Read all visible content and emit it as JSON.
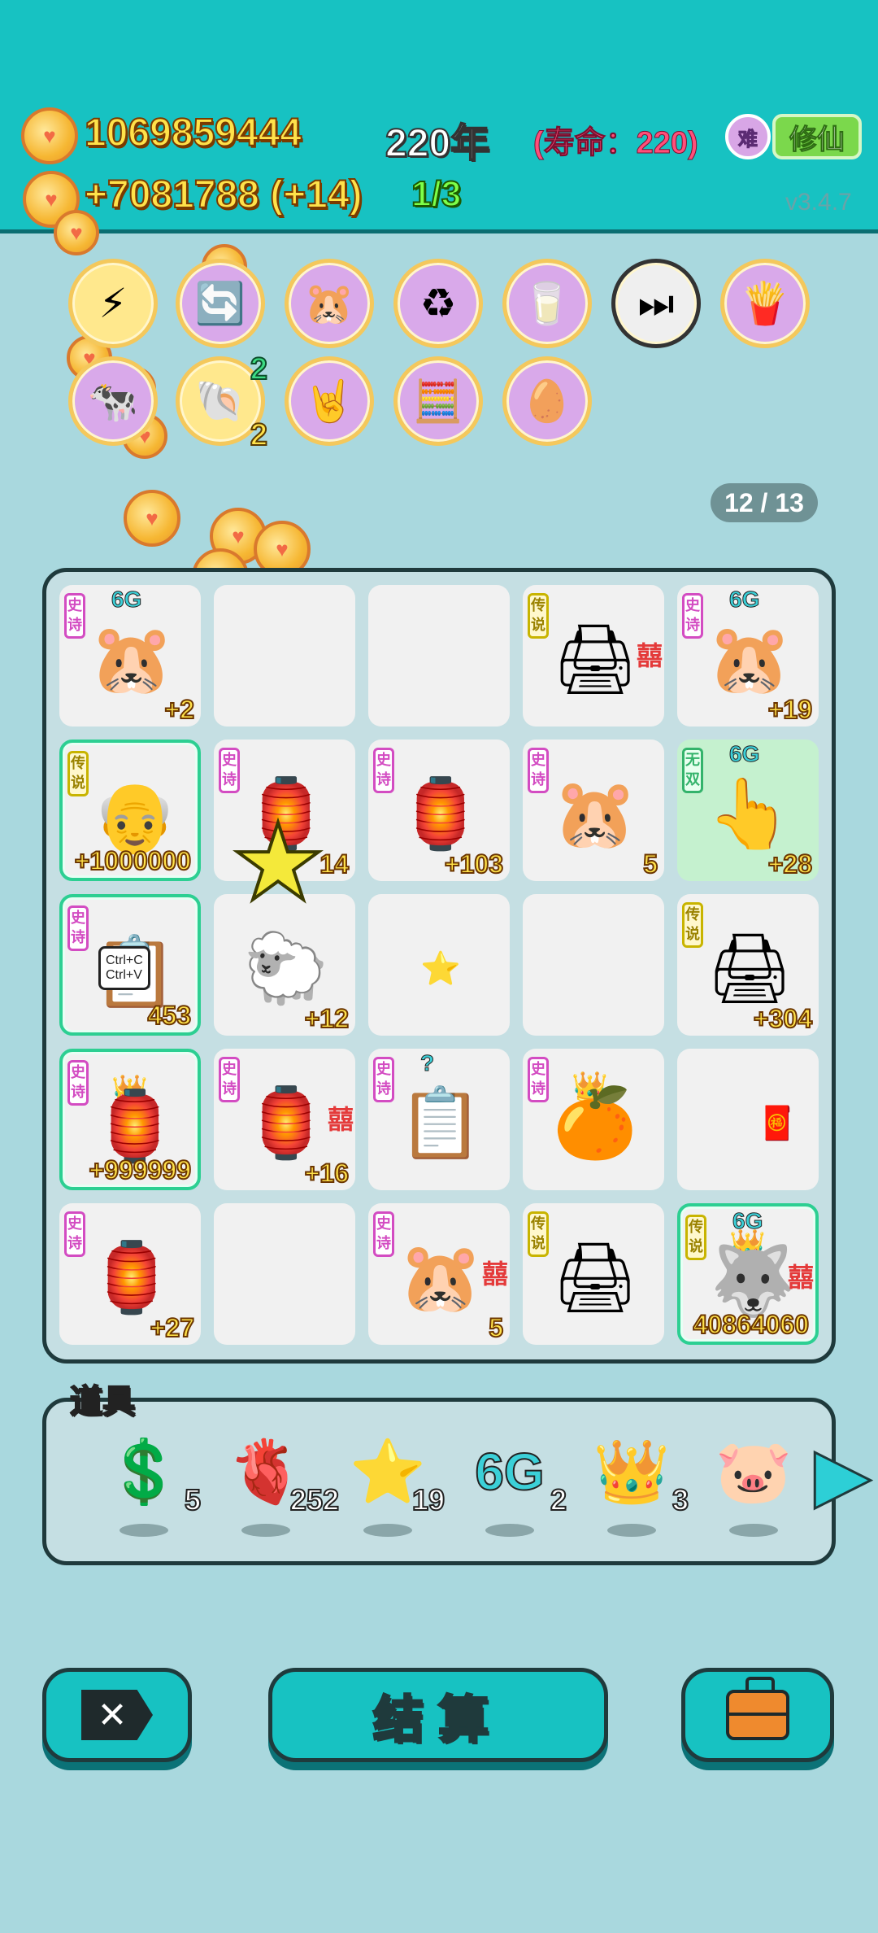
{
  "header": {
    "coins": "1069859444",
    "year": "220年",
    "lifespan": "(寿命：220)",
    "income": "+7081788 (+14)",
    "progress": "1/3",
    "difficulty": "难",
    "mode": "修仙",
    "version": "v3.4.7"
  },
  "relics": [
    {
      "icon": "lightning-icon",
      "glyph": "⚡",
      "count": ""
    },
    {
      "icon": "recycle-arrow-icon",
      "glyph": "🔄",
      "count": ""
    },
    {
      "icon": "three-hamsters-icon",
      "glyph": "🐹",
      "count": ""
    },
    {
      "icon": "recycle-icon",
      "glyph": "♻",
      "count": ""
    },
    {
      "icon": "milk-jar-icon",
      "glyph": "🥛",
      "count": ""
    },
    {
      "icon": "skip-icon",
      "glyph": "⏭",
      "count": ""
    },
    {
      "icon": "fries-icon",
      "glyph": "🍟",
      "count": ""
    },
    {
      "icon": "cow-icon",
      "glyph": "🐄",
      "count": ""
    },
    {
      "icon": "shell-icon",
      "glyph": "🐚",
      "count": "2",
      "top_count": "2"
    },
    {
      "icon": "rock-hand-icon",
      "glyph": "🤘",
      "count": ""
    },
    {
      "icon": "math-kid-icon",
      "glyph": "🧮",
      "count": ""
    },
    {
      "icon": "egg-icon",
      "glyph": "🥚",
      "count": ""
    }
  ],
  "board_page": "12 / 13",
  "tiles": [
    {
      "tag": "史诗",
      "badge": "6G",
      "symbol": "🐹",
      "value": "+2",
      "name": "hamster"
    },
    {
      "tag": "",
      "badge": "",
      "symbol": "",
      "value": "",
      "name": "empty"
    },
    {
      "tag": "",
      "badge": "",
      "symbol": "",
      "value": "",
      "name": "empty"
    },
    {
      "tag": "传说",
      "badge": "",
      "symbol": "🖨",
      "value": "",
      "name": "printer",
      "xi": "囍"
    },
    {
      "tag": "史诗",
      "badge": "6G",
      "symbol": "🐹",
      "value": "+19",
      "name": "hamster"
    },
    {
      "tag": "传说",
      "badge": "",
      "symbol": "👴",
      "value": "+1000000",
      "name": "old-man",
      "border": true
    },
    {
      "tag": "史诗",
      "badge": "",
      "symbol": "🏮",
      "value": "14",
      "name": "rabbit-tent"
    },
    {
      "tag": "史诗",
      "badge": "",
      "symbol": "🏮",
      "value": "+103",
      "name": "rabbit-tent"
    },
    {
      "tag": "史诗",
      "badge": "",
      "symbol": "🐹",
      "value": "5",
      "name": "hamster"
    },
    {
      "tag": "无双",
      "badge": "6G",
      "symbol": "👆",
      "value": "+28",
      "name": "pointing-hand",
      "green": true
    },
    {
      "tag": "史诗",
      "badge": "",
      "symbol": "📋",
      "value": "453",
      "name": "copy-paste",
      "border": true,
      "copy": "Ctrl+C\nCtrl+V"
    },
    {
      "tag": "",
      "badge": "",
      "symbol": "🐑",
      "value": "+12",
      "name": "sheep"
    },
    {
      "tag": "",
      "badge": "",
      "symbol": "⭐",
      "value": "",
      "name": "small-star"
    },
    {
      "tag": "",
      "badge": "",
      "symbol": "",
      "value": "",
      "name": "empty"
    },
    {
      "tag": "传说",
      "badge": "",
      "symbol": "🖨",
      "value": "+304",
      "name": "printer"
    },
    {
      "tag": "史诗",
      "badge": "",
      "symbol": "🏮",
      "value": "+999999",
      "name": "rabbit-tent-crowned",
      "border": true,
      "crown": true
    },
    {
      "tag": "史诗",
      "badge": "",
      "symbol": "🏮",
      "value": "+16",
      "name": "rabbit-tent",
      "xi": "囍"
    },
    {
      "tag": "史诗",
      "badge": "?",
      "symbol": "📋",
      "value": "",
      "name": "copy-paste"
    },
    {
      "tag": "史诗",
      "badge": "",
      "symbol": "🍊",
      "value": "",
      "name": "orange-crowned",
      "crown": true
    },
    {
      "tag": "",
      "badge": "",
      "symbol": "🧧",
      "value": "",
      "name": "fu-charm"
    },
    {
      "tag": "史诗",
      "badge": "",
      "symbol": "🏮",
      "value": "+27",
      "name": "rabbit-tent"
    },
    {
      "tag": "",
      "badge": "",
      "symbol": "",
      "value": "",
      "name": "empty"
    },
    {
      "tag": "史诗",
      "badge": "",
      "symbol": "🐹",
      "value": "5",
      "name": "hamster",
      "xi": "囍"
    },
    {
      "tag": "传说",
      "badge": "",
      "symbol": "🖨",
      "value": "",
      "name": "printer"
    },
    {
      "tag": "传说",
      "badge": "6G",
      "symbol": "🐺",
      "value": "40864060",
      "name": "husky-crowned",
      "border": true,
      "crown": true,
      "xi": "囍"
    }
  ],
  "items_label": "道具",
  "items": [
    {
      "icon": "dollar-coin-icon",
      "glyph": "💲",
      "qty": "5"
    },
    {
      "icon": "liver-icon",
      "glyph": "🫀",
      "qty": "252"
    },
    {
      "icon": "star-icon",
      "glyph": "⭐",
      "qty": "19"
    },
    {
      "icon": "6g-icon",
      "glyph": "6G",
      "qty": "2"
    },
    {
      "icon": "crown-icon",
      "glyph": "👑",
      "qty": "3"
    },
    {
      "icon": "piggy-bank-icon",
      "glyph": "🐷",
      "qty": ""
    }
  ],
  "buttons": {
    "close": "✕",
    "settle": "结算"
  }
}
